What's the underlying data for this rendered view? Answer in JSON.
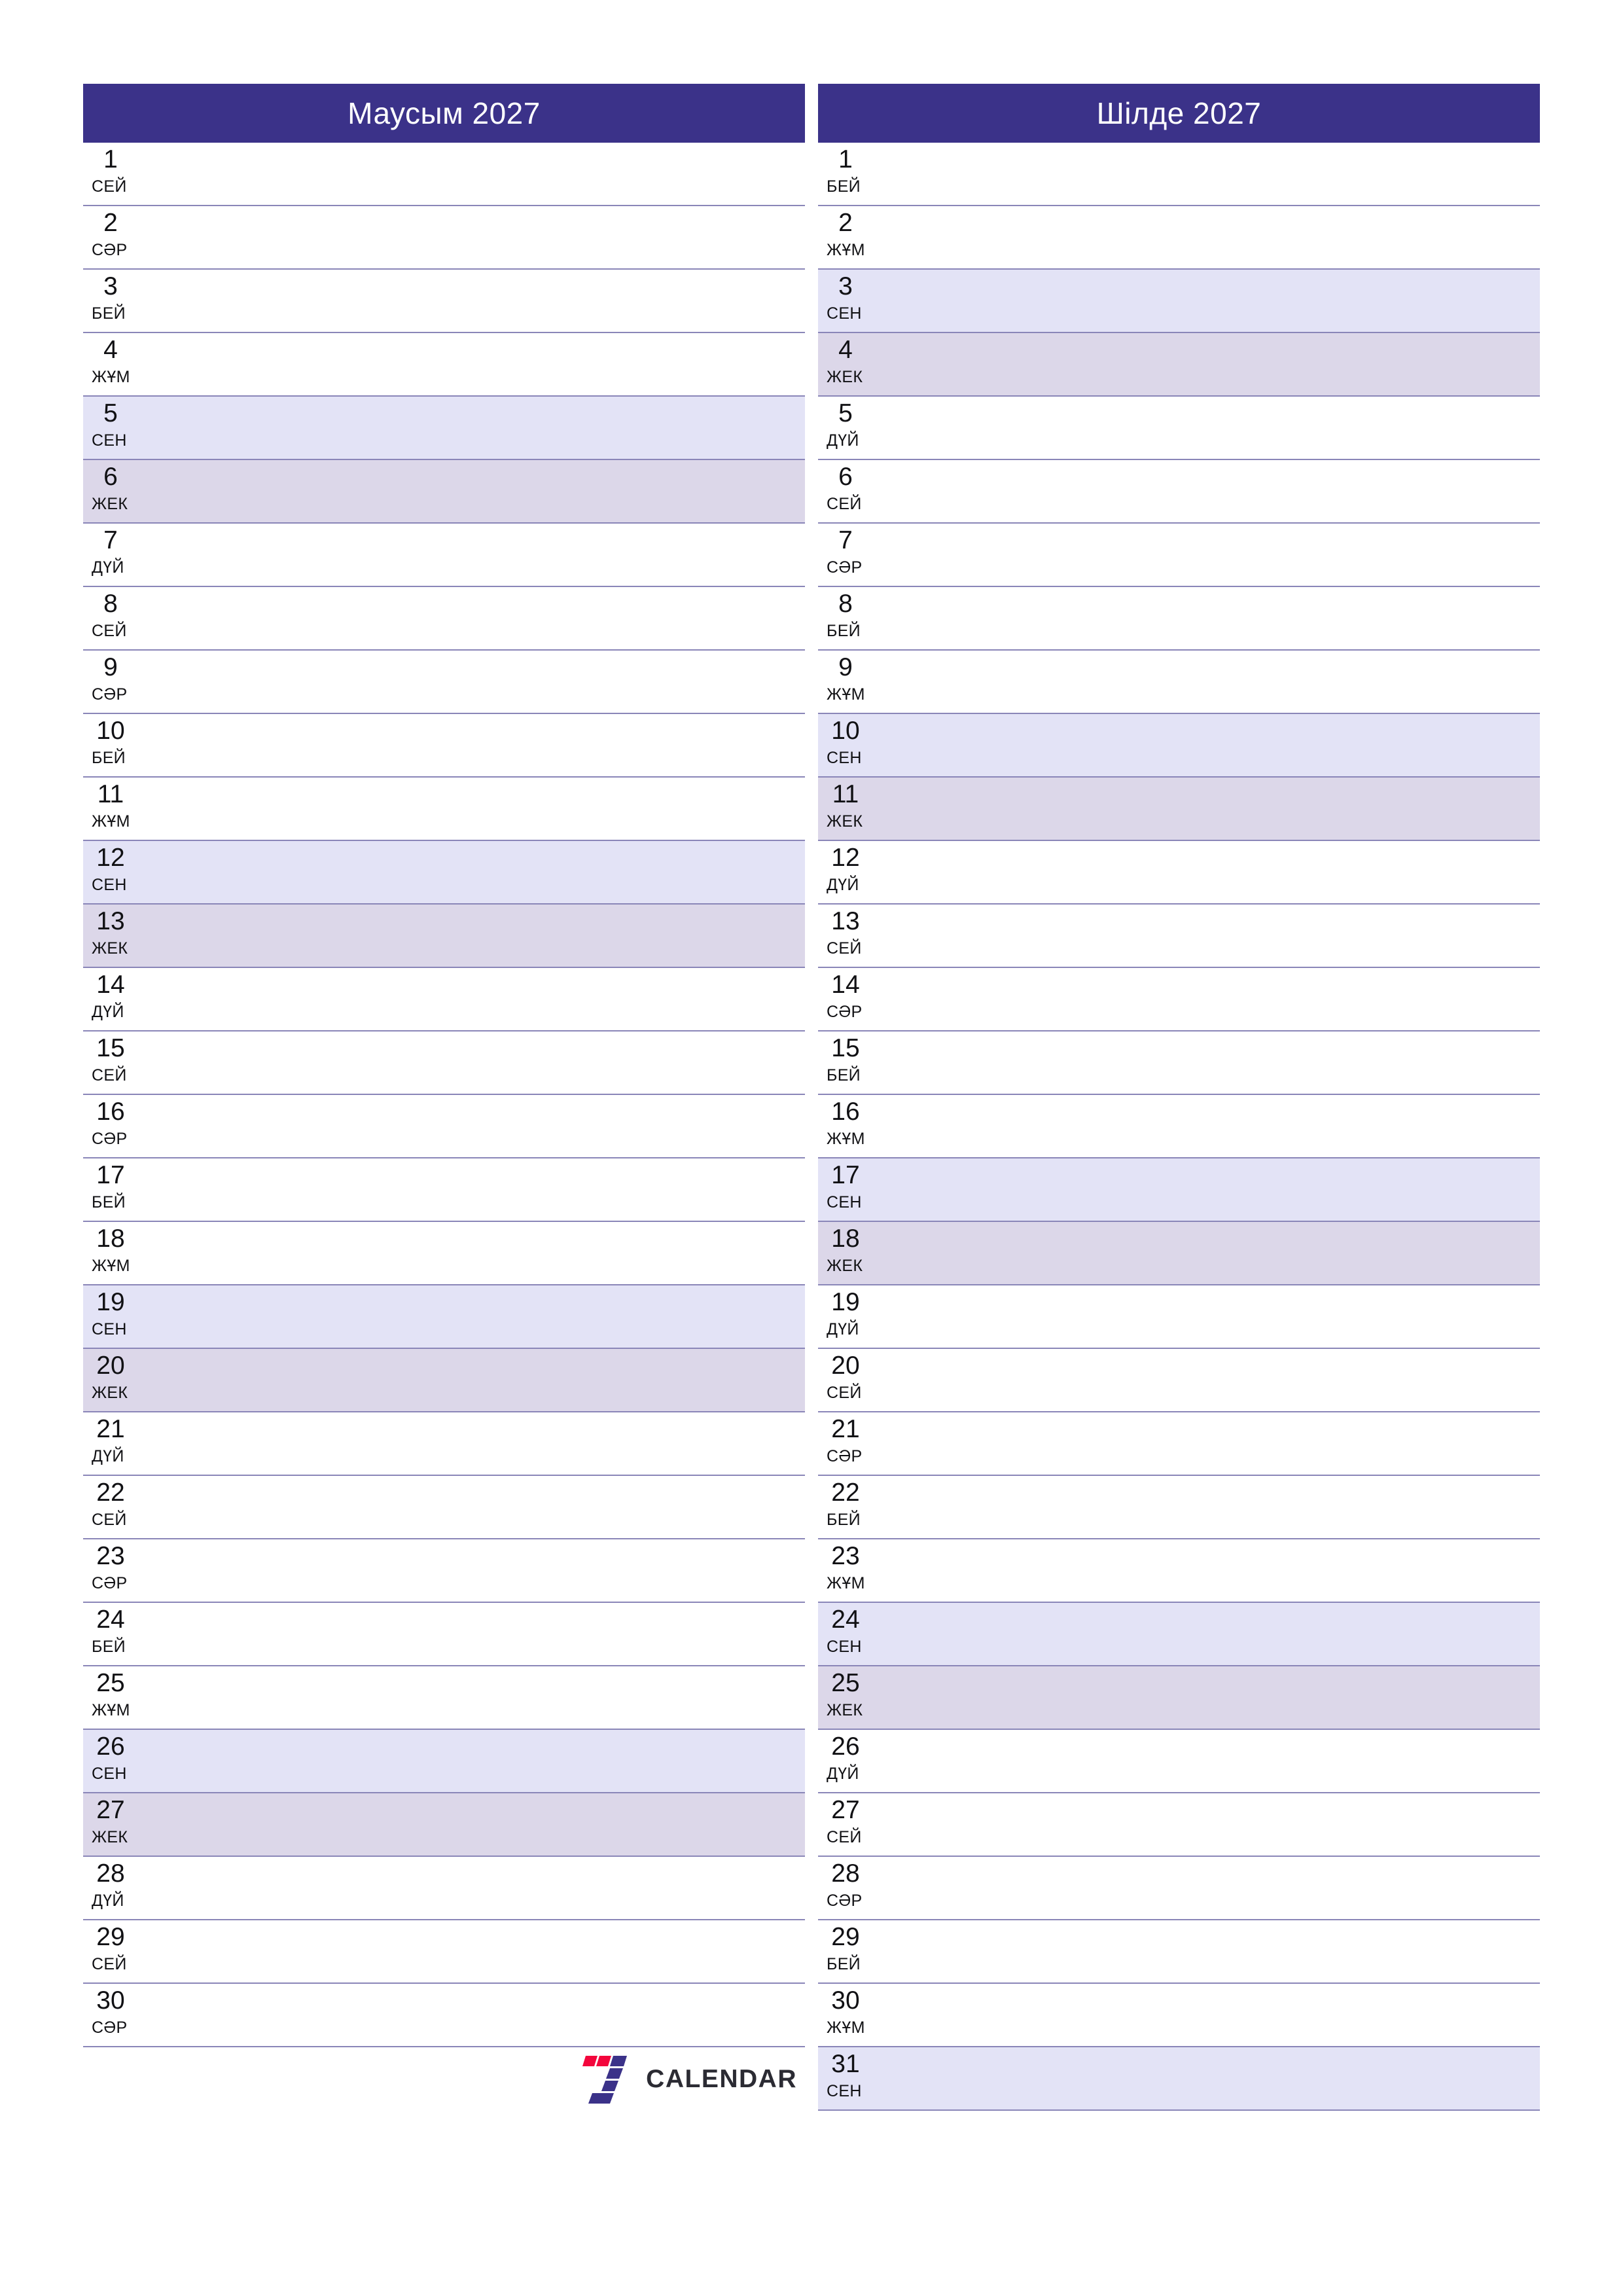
{
  "document": {
    "type": "two-month-planner",
    "year": "2027",
    "locale": "kk",
    "colors": {
      "header_background": "#3b3289",
      "header_text": "#ffffff",
      "saturday_row": "#e3e3f6",
      "sunday_row": "#dcd7e9",
      "row_divider": "#8a86b8",
      "page_background": "#ffffff",
      "day_text": "#111114",
      "logo_red": "#f3063c",
      "logo_purple": "#3b3289",
      "logo_word": "#2b2b33"
    }
  },
  "brand": {
    "word": "CALENDAR",
    "mark_name": "seven-logo-icon"
  },
  "months": [
    {
      "title": "Маусым 2027",
      "days": [
        {
          "num": "1",
          "abbr": "СЕЙ",
          "kind": "weekday"
        },
        {
          "num": "2",
          "abbr": "СӘР",
          "kind": "weekday"
        },
        {
          "num": "3",
          "abbr": "БЕЙ",
          "kind": "weekday"
        },
        {
          "num": "4",
          "abbr": "ЖҰМ",
          "kind": "weekday"
        },
        {
          "num": "5",
          "abbr": "СЕН",
          "kind": "sat"
        },
        {
          "num": "6",
          "abbr": "ЖЕК",
          "kind": "sun"
        },
        {
          "num": "7",
          "abbr": "ДҮЙ",
          "kind": "weekday"
        },
        {
          "num": "8",
          "abbr": "СЕЙ",
          "kind": "weekday"
        },
        {
          "num": "9",
          "abbr": "СӘР",
          "kind": "weekday"
        },
        {
          "num": "10",
          "abbr": "БЕЙ",
          "kind": "weekday"
        },
        {
          "num": "11",
          "abbr": "ЖҰМ",
          "kind": "weekday"
        },
        {
          "num": "12",
          "abbr": "СЕН",
          "kind": "sat"
        },
        {
          "num": "13",
          "abbr": "ЖЕК",
          "kind": "sun"
        },
        {
          "num": "14",
          "abbr": "ДҮЙ",
          "kind": "weekday"
        },
        {
          "num": "15",
          "abbr": "СЕЙ",
          "kind": "weekday"
        },
        {
          "num": "16",
          "abbr": "СӘР",
          "kind": "weekday"
        },
        {
          "num": "17",
          "abbr": "БЕЙ",
          "kind": "weekday"
        },
        {
          "num": "18",
          "abbr": "ЖҰМ",
          "kind": "weekday"
        },
        {
          "num": "19",
          "abbr": "СЕН",
          "kind": "sat"
        },
        {
          "num": "20",
          "abbr": "ЖЕК",
          "kind": "sun"
        },
        {
          "num": "21",
          "abbr": "ДҮЙ",
          "kind": "weekday"
        },
        {
          "num": "22",
          "abbr": "СЕЙ",
          "kind": "weekday"
        },
        {
          "num": "23",
          "abbr": "СӘР",
          "kind": "weekday"
        },
        {
          "num": "24",
          "abbr": "БЕЙ",
          "kind": "weekday"
        },
        {
          "num": "25",
          "abbr": "ЖҰМ",
          "kind": "weekday"
        },
        {
          "num": "26",
          "abbr": "СЕН",
          "kind": "sat"
        },
        {
          "num": "27",
          "abbr": "ЖЕК",
          "kind": "sun"
        },
        {
          "num": "28",
          "abbr": "ДҮЙ",
          "kind": "weekday"
        },
        {
          "num": "29",
          "abbr": "СЕЙ",
          "kind": "weekday"
        },
        {
          "num": "30",
          "abbr": "СӘР",
          "kind": "weekday"
        }
      ]
    },
    {
      "title": "Шілде 2027",
      "days": [
        {
          "num": "1",
          "abbr": "БЕЙ",
          "kind": "weekday"
        },
        {
          "num": "2",
          "abbr": "ЖҰМ",
          "kind": "weekday"
        },
        {
          "num": "3",
          "abbr": "СЕН",
          "kind": "sat"
        },
        {
          "num": "4",
          "abbr": "ЖЕК",
          "kind": "sun"
        },
        {
          "num": "5",
          "abbr": "ДҮЙ",
          "kind": "weekday"
        },
        {
          "num": "6",
          "abbr": "СЕЙ",
          "kind": "weekday"
        },
        {
          "num": "7",
          "abbr": "СӘР",
          "kind": "weekday"
        },
        {
          "num": "8",
          "abbr": "БЕЙ",
          "kind": "weekday"
        },
        {
          "num": "9",
          "abbr": "ЖҰМ",
          "kind": "weekday"
        },
        {
          "num": "10",
          "abbr": "СЕН",
          "kind": "sat"
        },
        {
          "num": "11",
          "abbr": "ЖЕК",
          "kind": "sun"
        },
        {
          "num": "12",
          "abbr": "ДҮЙ",
          "kind": "weekday"
        },
        {
          "num": "13",
          "abbr": "СЕЙ",
          "kind": "weekday"
        },
        {
          "num": "14",
          "abbr": "СӘР",
          "kind": "weekday"
        },
        {
          "num": "15",
          "abbr": "БЕЙ",
          "kind": "weekday"
        },
        {
          "num": "16",
          "abbr": "ЖҰМ",
          "kind": "weekday"
        },
        {
          "num": "17",
          "abbr": "СЕН",
          "kind": "sat"
        },
        {
          "num": "18",
          "abbr": "ЖЕК",
          "kind": "sun"
        },
        {
          "num": "19",
          "abbr": "ДҮЙ",
          "kind": "weekday"
        },
        {
          "num": "20",
          "abbr": "СЕЙ",
          "kind": "weekday"
        },
        {
          "num": "21",
          "abbr": "СӘР",
          "kind": "weekday"
        },
        {
          "num": "22",
          "abbr": "БЕЙ",
          "kind": "weekday"
        },
        {
          "num": "23",
          "abbr": "ЖҰМ",
          "kind": "weekday"
        },
        {
          "num": "24",
          "abbr": "СЕН",
          "kind": "sat"
        },
        {
          "num": "25",
          "abbr": "ЖЕК",
          "kind": "sun"
        },
        {
          "num": "26",
          "abbr": "ДҮЙ",
          "kind": "weekday"
        },
        {
          "num": "27",
          "abbr": "СЕЙ",
          "kind": "weekday"
        },
        {
          "num": "28",
          "abbr": "СӘР",
          "kind": "weekday"
        },
        {
          "num": "29",
          "abbr": "БЕЙ",
          "kind": "weekday"
        },
        {
          "num": "30",
          "abbr": "ЖҰМ",
          "kind": "weekday"
        },
        {
          "num": "31",
          "abbr": "СЕН",
          "kind": "sat"
        }
      ]
    }
  ]
}
